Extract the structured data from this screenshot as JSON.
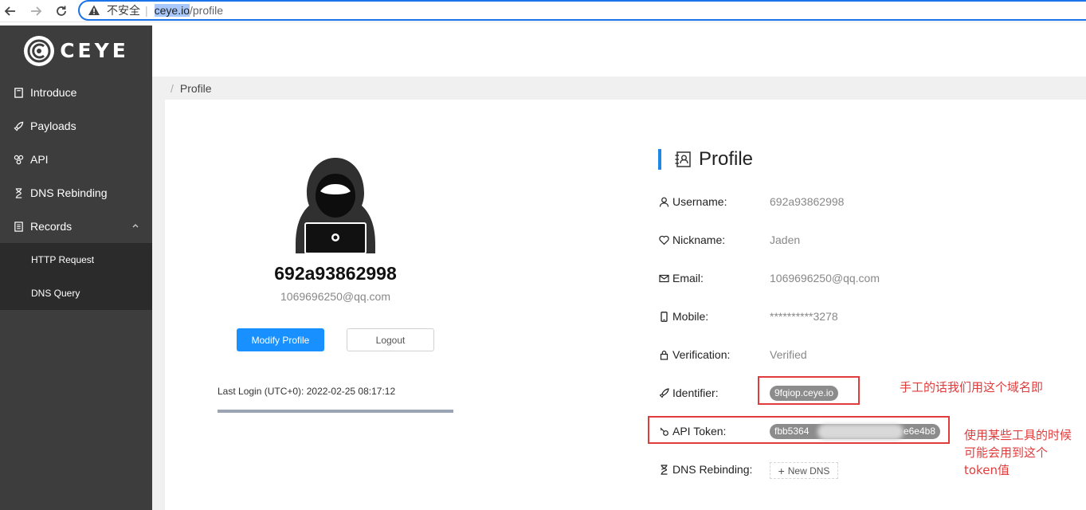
{
  "browser": {
    "insecure_label": "不安全",
    "url_host": "ceye.io",
    "url_path": "/profile"
  },
  "sidebar": {
    "logo_text": "CEYE",
    "items": [
      {
        "label": "Introduce",
        "icon": "book-icon"
      },
      {
        "label": "Payloads",
        "icon": "rocket-icon"
      },
      {
        "label": "API",
        "icon": "api-icon"
      },
      {
        "label": "DNS Rebinding",
        "icon": "hourglass-icon"
      },
      {
        "label": "Records",
        "icon": "records-icon"
      }
    ],
    "submenu": [
      {
        "label": "HTTP Request"
      },
      {
        "label": "DNS Query"
      }
    ]
  },
  "breadcrumb": {
    "separator": "/",
    "current": "Profile"
  },
  "profile_card": {
    "username": "692a93862998",
    "email": "1069696250@qq.com",
    "modify_label": "Modify Profile",
    "logout_label": "Logout",
    "last_login": "Last Login (UTC+0): 2022-02-25 08:17:12"
  },
  "detail": {
    "title": "Profile",
    "rows": [
      {
        "label": "Username:",
        "value": "692a93862998",
        "icon": "user-icon"
      },
      {
        "label": "Nickname:",
        "value": "Jaden",
        "icon": "heart-icon"
      },
      {
        "label": "Email:",
        "value": "1069696250@qq.com",
        "icon": "mail-icon"
      },
      {
        "label": "Mobile:",
        "value": "**********3278",
        "icon": "mobile-icon"
      },
      {
        "label": "Verification:",
        "value": "Verified",
        "icon": "lock-icon"
      },
      {
        "label": "Identifier:",
        "value": "9fqiop.ceye.io",
        "icon": "rocket-icon"
      },
      {
        "label": "API Token:",
        "value_start": "fbb5364",
        "value_end": "e6e4b8",
        "icon": "key-icon"
      },
      {
        "label": "DNS Rebinding:",
        "value": "New DNS",
        "icon": "hourglass-icon"
      }
    ]
  },
  "annotations": {
    "identifier_note": "手工的话我们用这个域名即",
    "token_note_line1": "使用某些工具的时候",
    "token_note_line2": "可能会用到这个",
    "token_note_line3": "token值",
    "color": "#e03c3c"
  },
  "colors": {
    "sidebar_bg": "#3d3d3d",
    "submenu_bg": "#2b2b2b",
    "primary": "#1890ff",
    "accent_bar": "#1e88e5"
  }
}
